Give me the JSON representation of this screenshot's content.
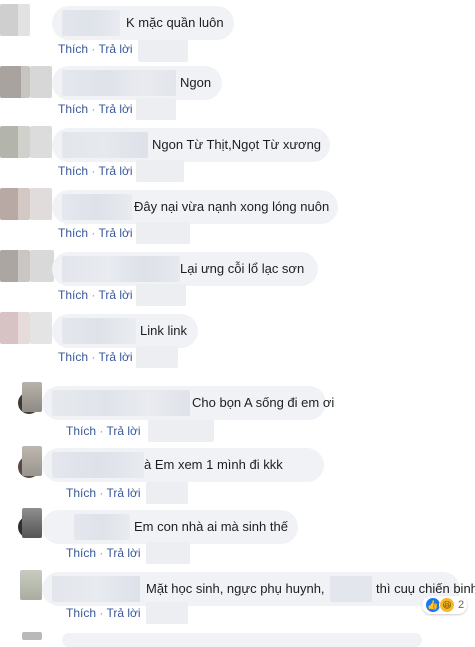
{
  "comments": [
    {
      "text": "K mặc quần luôn",
      "like": "Thích",
      "reply": "Trả lời"
    },
    {
      "text": "Ngon",
      "like": "Thích",
      "reply": "Trả lời"
    },
    {
      "text": "Ngon Từ Thịt,Ngọt Từ xương",
      "like": "Thích",
      "reply": "Trả lời"
    },
    {
      "text": "Đây nại vừa nạnh xong lóng nuôn",
      "like": "Thích",
      "reply": "Trả lời"
    },
    {
      "text": "Lại ưng cỗi lổ lạc sơn",
      "like": "Thích",
      "reply": "Trả lời"
    },
    {
      "text": "Link link",
      "like": "Thích",
      "reply": "Trả lời"
    }
  ],
  "replies": [
    {
      "text": "Cho bọn A sống đi em ơi",
      "like": "Thích",
      "reply": "Trả lời"
    },
    {
      "text": "à Em xem 1 mình đi kkk",
      "like": "Thích",
      "reply": "Trả lời"
    },
    {
      "text": "Em con nhà ai mà sinh thế",
      "like": "Thích",
      "reply": "Trả lời"
    },
    {
      "text": "Mặt học sinh, ngực phụ huynh,",
      "text2": "thì cuụ chiến binh...",
      "like": "Thích",
      "reply": "Trả lời",
      "reactions": {
        "icons": [
          "like-icon",
          "haha-icon"
        ],
        "count": "2"
      }
    }
  ],
  "colors": {
    "bubble": "#f0f2f5",
    "link": "#385898",
    "text": "#1c1e21"
  }
}
